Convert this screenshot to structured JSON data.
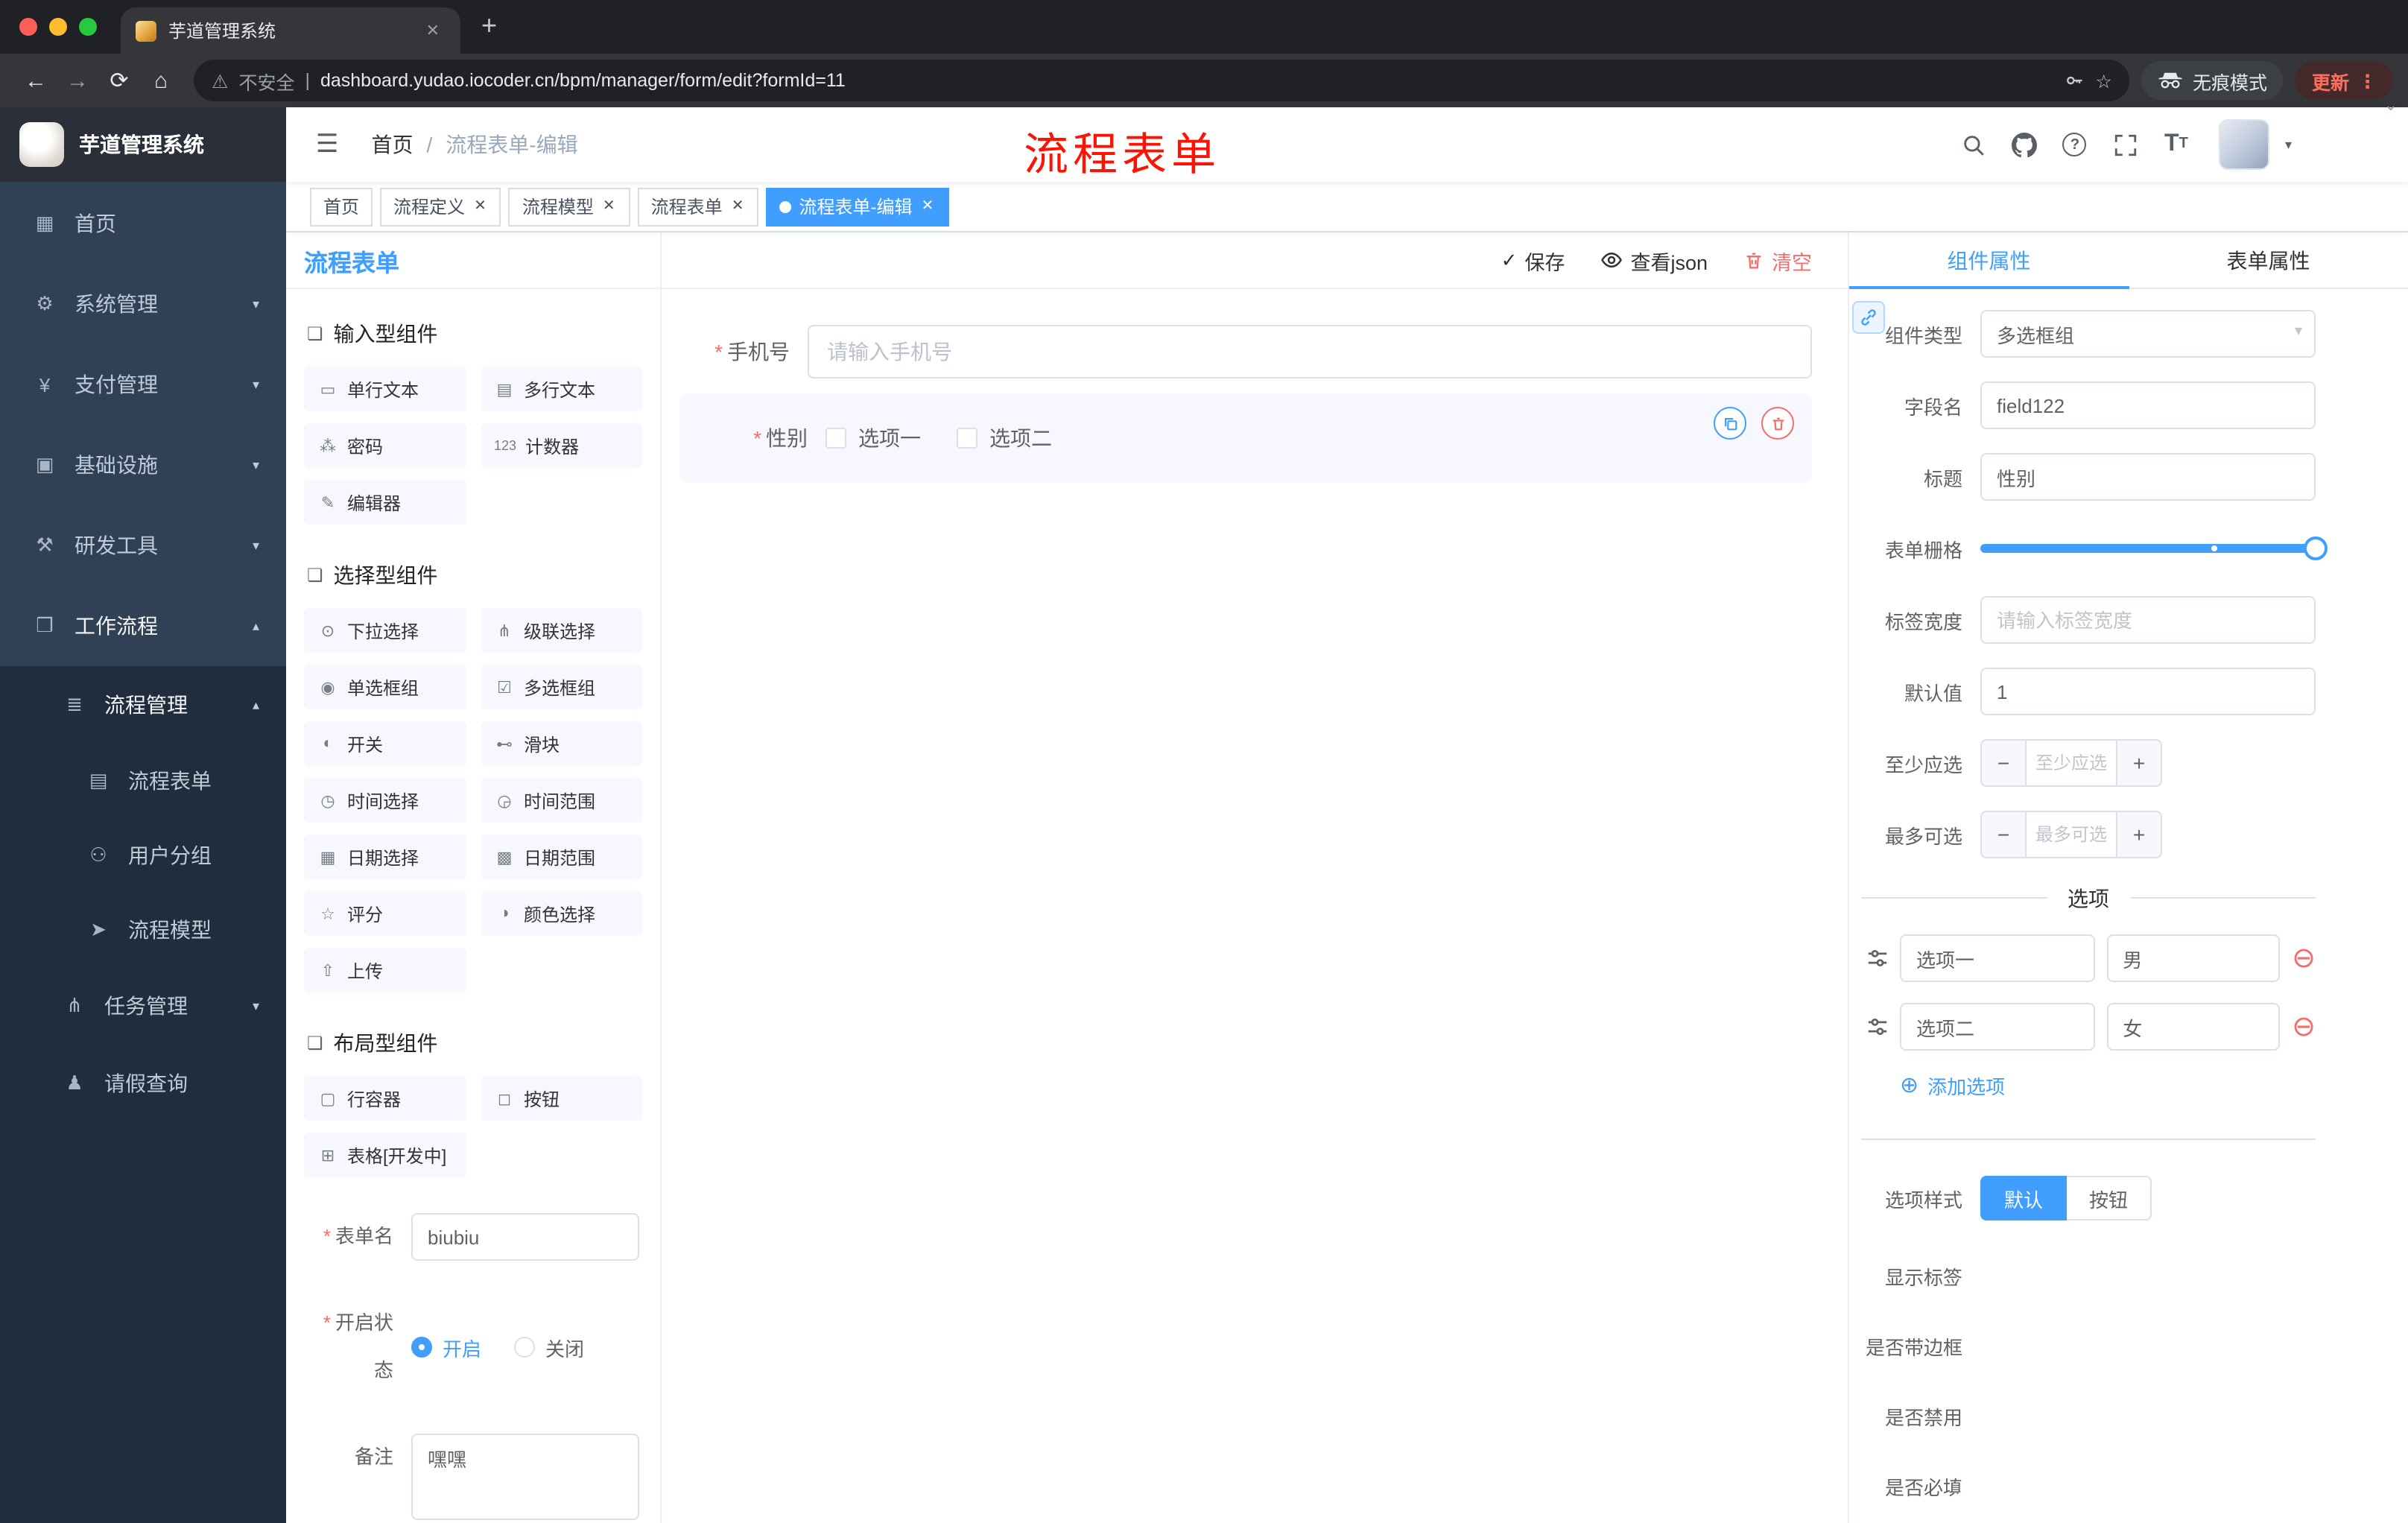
{
  "glyphs": {
    "back": "←",
    "forward": "→",
    "reload": "⟳",
    "home": "⌂",
    "warning": "⚠",
    "pipe": "|",
    "star": "☆",
    "dots": "⋮",
    "new_tab": "+",
    "close": "✕",
    "hamburger": "☰",
    "caret": "▾",
    "caret_small": "⌄",
    "check": "✓",
    "required": "*",
    "plus_circle": "⊕",
    "minus_circle": "⊖",
    "question": "?",
    "section": "❏",
    "font_size_main": "T",
    "font_size_sub": "T"
  },
  "colors": {
    "accent": "#409EFF",
    "danger": "#F56C6C",
    "annotation_red": "#FB1303"
  },
  "browser": {
    "tab_title": "芋道管理系统",
    "security_label": "不安全",
    "url": "dashboard.yudao.iocoder.cn/bpm/manager/form/edit?formId=11",
    "incognito_label": "无痕模式",
    "update_label": "更新"
  },
  "sidebar": {
    "logo_title": "芋道管理系统",
    "items": [
      {
        "label": "首页",
        "icon": "▦"
      },
      {
        "label": "系统管理",
        "icon": "⚙",
        "chevron": "▾"
      },
      {
        "label": "支付管理",
        "icon": "¥",
        "chevron": "▾"
      },
      {
        "label": "基础设施",
        "icon": "▣",
        "chevron": "▾"
      },
      {
        "label": "研发工具",
        "icon": "⚒",
        "chevron": "▾"
      },
      {
        "label": "工作流程",
        "icon": "❒",
        "chevron": "▴"
      },
      {
        "label": "流程管理",
        "icon": "≣",
        "chevron": "▴"
      },
      {
        "label": "流程表单",
        "icon": "▤"
      },
      {
        "label": "用户分组",
        "icon": "⚇"
      },
      {
        "label": "流程模型",
        "icon": "➤"
      },
      {
        "label": "任务管理",
        "icon": "⋔",
        "chevron": "▾"
      },
      {
        "label": "请假查询",
        "icon": "♟"
      }
    ]
  },
  "header": {
    "breadcrumb_home": "首页",
    "breadcrumb_sep": "/",
    "breadcrumb_current": "流程表单-编辑",
    "annotation": "流程表单"
  },
  "tags": [
    {
      "label": "首页"
    },
    {
      "label": "流程定义"
    },
    {
      "label": "流程模型"
    },
    {
      "label": "流程表单"
    },
    {
      "label": "流程表单-编辑"
    }
  ],
  "palette": {
    "title": "流程表单",
    "sections": [
      {
        "title": "输入型组件",
        "items": [
          {
            "label": "单行文本",
            "icon": "▭"
          },
          {
            "label": "多行文本",
            "icon": "▤"
          },
          {
            "label": "密码",
            "icon": "⁂"
          },
          {
            "label": "计数器",
            "icon": "123"
          },
          {
            "label": "编辑器",
            "icon": "✎"
          }
        ]
      },
      {
        "title": "选择型组件",
        "items": [
          {
            "label": "下拉选择",
            "icon": "⊙"
          },
          {
            "label": "级联选择",
            "icon": "⋔"
          },
          {
            "label": "单选框组",
            "icon": "◉"
          },
          {
            "label": "多选框组",
            "icon": "☑"
          },
          {
            "label": "开关",
            "icon": "◐"
          },
          {
            "label": "滑块",
            "icon": "⊷"
          },
          {
            "label": "时间选择",
            "icon": "◷"
          },
          {
            "label": "时间范围",
            "icon": "◶"
          },
          {
            "label": "日期选择",
            "icon": "▦"
          },
          {
            "label": "日期范围",
            "icon": "▩"
          },
          {
            "label": "评分",
            "icon": "☆"
          },
          {
            "label": "颜色选择",
            "icon": "◑"
          },
          {
            "label": "上传",
            "icon": "⇧"
          }
        ]
      },
      {
        "title": "布局型组件",
        "items": [
          {
            "label": "行容器",
            "icon": "▢"
          },
          {
            "label": "按钮",
            "icon": "◻"
          },
          {
            "label": "表格[开发中]",
            "icon": "⊞"
          }
        ]
      }
    ],
    "form": {
      "name_label": "表单名",
      "name_value": "biubiu",
      "status_label": "开启状态",
      "status_on": "开启",
      "status_off": "关闭",
      "remark_label": "备注",
      "remark_value": "嘿嘿"
    }
  },
  "canvas": {
    "save_label": "保存",
    "view_json_label": "查看json",
    "clear_label": "清空",
    "phone_label": "手机号",
    "phone_placeholder": "请输入手机号",
    "gender_label": "性别",
    "gender_option1": "选项一",
    "gender_option2": "选项二"
  },
  "props": {
    "tab_component": "组件属性",
    "tab_form": "表单属性",
    "component_type_label": "组件类型",
    "component_type_value": "多选框组",
    "field_name_label": "字段名",
    "field_name_value": "field122",
    "title_label": "标题",
    "title_value": "性别",
    "grid_label": "表单栅格",
    "label_width_label": "标签宽度",
    "label_width_placeholder": "请输入标签宽度",
    "default_label": "默认值",
    "default_value": "1",
    "min_label": "至少应选",
    "min_placeholder": "至少应选",
    "max_label": "最多可选",
    "max_placeholder": "最多可选",
    "options_title": "选项",
    "options": [
      {
        "label": "选项一",
        "value": "男"
      },
      {
        "label": "选项二",
        "value": "女"
      }
    ],
    "add_option_label": "添加选项",
    "style_label": "选项样式",
    "style_default": "默认",
    "style_button": "按钮",
    "switch_show_label": "显示标签",
    "switch_border": "是否带边框",
    "switch_disabled": "是否禁用",
    "switch_required": "是否必填"
  }
}
